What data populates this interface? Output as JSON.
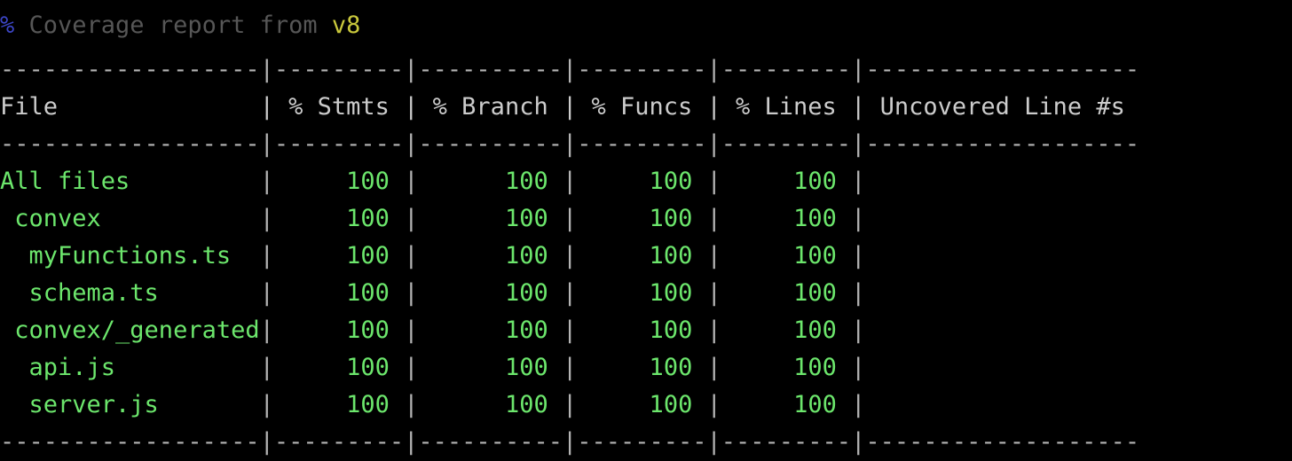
{
  "terminal": {
    "background": "#000000",
    "title": {
      "percent_symbol": "%",
      "text": " Coverage report from ",
      "tool": "v8",
      "percent_color": "#3b45c4",
      "text_color": "#565656",
      "tool_color": "#c9c83c"
    },
    "colors": {
      "separator": "#b4b4b4",
      "header_text": "#cccccc",
      "full_coverage": "#6ce66c",
      "pipe": "#b4b4b4"
    }
  },
  "table": {
    "separator_line": "------------------|---------|----------|---------|---------|-------------------",
    "columns": [
      {
        "label": "File",
        "align": "left",
        "width": 18
      },
      {
        "label": "% Stmts",
        "align": "right",
        "width": 9
      },
      {
        "label": "% Branch",
        "align": "right",
        "width": 10
      },
      {
        "label": "% Funcs",
        "align": "right",
        "width": 9
      },
      {
        "label": "% Lines",
        "align": "right",
        "width": 9
      },
      {
        "label": "Uncovered Line #s",
        "align": "left",
        "width": 19
      }
    ],
    "header_row": "File              | % Stmts | % Branch | % Funcs | % Lines | Uncovered Line #s",
    "rows": [
      {
        "file": "All files",
        "indent": 0,
        "stmts": "100",
        "branch": "100",
        "funcs": "100",
        "lines": "100",
        "uncovered": "",
        "row_text": "All files         |     100 |      100 |     100 |     100 |"
      },
      {
        "file": "convex",
        "indent": 1,
        "stmts": "100",
        "branch": "100",
        "funcs": "100",
        "lines": "100",
        "uncovered": "",
        "row_text": " convex           |     100 |      100 |     100 |     100 |"
      },
      {
        "file": "myFunctions.ts",
        "indent": 2,
        "stmts": "100",
        "branch": "100",
        "funcs": "100",
        "lines": "100",
        "uncovered": "",
        "row_text": "  myFunctions.ts  |     100 |      100 |     100 |     100 |"
      },
      {
        "file": "schema.ts",
        "indent": 2,
        "stmts": "100",
        "branch": "100",
        "funcs": "100",
        "lines": "100",
        "uncovered": "",
        "row_text": "  schema.ts       |     100 |      100 |     100 |     100 |"
      },
      {
        "file": "convex/_generated",
        "indent": 1,
        "stmts": "100",
        "branch": "100",
        "funcs": "100",
        "lines": "100",
        "uncovered": "",
        "row_text": " convex/_generated|     100 |      100 |     100 |     100 |"
      },
      {
        "file": "api.js",
        "indent": 2,
        "stmts": "100",
        "branch": "100",
        "funcs": "100",
        "lines": "100",
        "uncovered": "",
        "row_text": "  api.js          |     100 |      100 |     100 |     100 |"
      },
      {
        "file": "server.js",
        "indent": 2,
        "stmts": "100",
        "branch": "100",
        "funcs": "100",
        "lines": "100",
        "uncovered": "",
        "row_text": "  server.js       |     100 |      100 |     100 |     100 |"
      }
    ]
  }
}
